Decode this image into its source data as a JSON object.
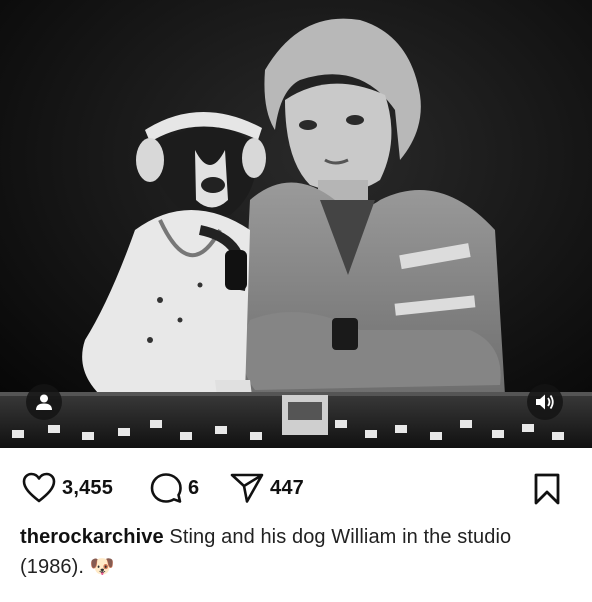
{
  "post": {
    "image_alt": "Black and white photo of Sting with his dog William wearing headphones at a studio mixing console",
    "user_tag_icon": "person-icon",
    "sound_icon": "speaker-icon"
  },
  "actions": {
    "like_icon": "heart-icon",
    "likes": "3,455",
    "comment_icon": "comment-icon",
    "comments": "6",
    "share_icon": "send-icon",
    "shares": "447",
    "save_icon": "bookmark-icon"
  },
  "caption": {
    "username": "therockarchive",
    "text": "Sting and his dog William in the studio (1986).",
    "emoji": "🐶"
  }
}
